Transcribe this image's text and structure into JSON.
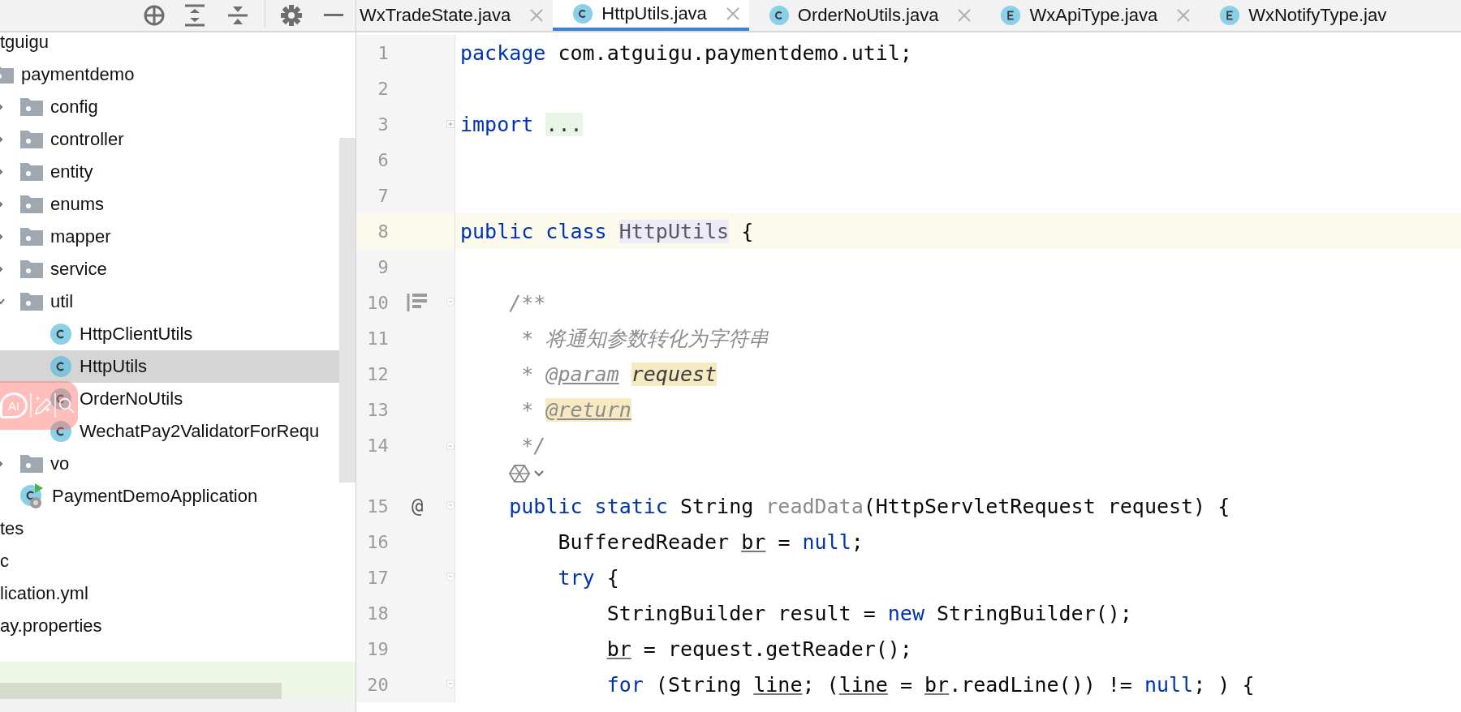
{
  "project_panel": {
    "tree": [
      {
        "label": "tguigu",
        "selected": false,
        "children": [
          {
            "label": "paymentdemo",
            "kind": "folder",
            "selected": false,
            "children": [
              {
                "label": "config",
                "kind": "folder",
                "expanded": false,
                "selected": false
              },
              {
                "label": "controller",
                "kind": "folder",
                "expanded": false,
                "selected": false
              },
              {
                "label": "entity",
                "kind": "folder",
                "expanded": false,
                "selected": false
              },
              {
                "label": "enums",
                "kind": "folder",
                "expanded": false,
                "selected": false
              },
              {
                "label": "mapper",
                "kind": "folder",
                "expanded": false,
                "selected": false
              },
              {
                "label": "service",
                "kind": "folder",
                "expanded": false,
                "selected": false
              },
              {
                "label": "util",
                "kind": "folder",
                "expanded": true,
                "selected": false,
                "children": [
                  {
                    "label": "HttpClientUtils",
                    "kind": "class",
                    "selected": false
                  },
                  {
                    "label": "HttpUtils",
                    "kind": "class",
                    "selected": true
                  },
                  {
                    "label": "OrderNoUtils",
                    "kind": "class",
                    "selected": false
                  },
                  {
                    "label": "WechatPay2ValidatorForRequ",
                    "kind": "class",
                    "selected": false
                  }
                ]
              },
              {
                "label": "vo",
                "kind": "folder",
                "expanded": false,
                "selected": false
              },
              {
                "label": "PaymentDemoApplication",
                "kind": "app-class",
                "selected": false
              }
            ]
          }
        ]
      },
      {
        "label": "tes",
        "selected": false
      },
      {
        "label": "c",
        "selected": false
      },
      {
        "label": "lication.yml",
        "selected": false
      },
      {
        "label": "ay.properties",
        "selected": false
      }
    ]
  },
  "overlay_menu": {
    "label": "AI"
  },
  "tabs": [
    {
      "label": "WxTradeState.java",
      "closable": true,
      "selected": false
    },
    {
      "label": "HttpUtils.java",
      "kind": "class",
      "closable": true,
      "selected": true
    },
    {
      "label": "OrderNoUtils.java",
      "kind": "class",
      "closable": true,
      "selected": false
    },
    {
      "label": "WxApiType.java",
      "kind": "enum",
      "closable": true,
      "selected": false
    },
    {
      "label": "WxNotifyType.jav",
      "kind": "enum",
      "closable": false,
      "selected": false
    }
  ],
  "editor": {
    "lines": [
      {
        "kind": "code",
        "number": "1",
        "tokens": [
          {
            "text": "package ",
            "kind": "keyword"
          },
          {
            "text": "com.atguigu.paymentdemo.util;",
            "kind": "plain"
          }
        ]
      },
      {
        "kind": "code",
        "number": "2"
      },
      {
        "kind": "code",
        "number": "3",
        "fold": {
          "kind": "collapsed"
        },
        "tokens": [
          {
            "text": "import ",
            "kind": "keyword"
          },
          {
            "text": "...",
            "kind": "folded"
          }
        ]
      },
      {
        "kind": "code",
        "number": "6"
      },
      {
        "kind": "code",
        "number": "7"
      },
      {
        "kind": "code",
        "number": "8",
        "current": true,
        "tokens": [
          {
            "text": "public class ",
            "kind": "keyword"
          },
          {
            "text": "HttpUtils",
            "kind": "declared"
          },
          {
            "text": " {",
            "kind": "plain"
          }
        ]
      },
      {
        "kind": "code",
        "number": "9"
      },
      {
        "kind": "code",
        "number": "10",
        "doc_toggle": true,
        "fold": {
          "kind": "start"
        },
        "tokens": [
          {
            "text": "    /**",
            "kind": "comment"
          }
        ]
      },
      {
        "kind": "code",
        "number": "11",
        "tokens": [
          {
            "text": "     * 将通知参数转化为字符串",
            "kind": "comment"
          }
        ]
      },
      {
        "kind": "code",
        "number": "12",
        "tokens": [
          {
            "text": "     * ",
            "kind": "comment"
          },
          {
            "text": "@param",
            "kind": "doctag"
          },
          {
            "text": " request",
            "kind": "docparam"
          }
        ]
      },
      {
        "kind": "code",
        "number": "13",
        "tokens": [
          {
            "text": "     * ",
            "kind": "comment"
          },
          {
            "text": "@return",
            "kind": "doctag-marked"
          }
        ]
      },
      {
        "kind": "code",
        "number": "14",
        "fold": {
          "kind": "end"
        },
        "tokens": [
          {
            "text": "     */",
            "kind": "comment"
          }
        ]
      },
      {
        "kind": "inlay"
      },
      {
        "kind": "code",
        "number": "15",
        "gutter_text": "@",
        "fold": {
          "kind": "start"
        },
        "tokens": [
          {
            "text": "    public static ",
            "kind": "keyword"
          },
          {
            "text": "String ",
            "kind": "plain"
          },
          {
            "text": "readData",
            "kind": "unused"
          },
          {
            "text": "(HttpServletRequest request) {",
            "kind": "plain"
          }
        ]
      },
      {
        "kind": "code",
        "number": "16",
        "tokens": [
          {
            "text": "        BufferedReader ",
            "kind": "plain"
          },
          {
            "text": "br",
            "kind": "variable"
          },
          {
            "text": " = ",
            "kind": "plain"
          },
          {
            "text": "null",
            "kind": "keyword"
          },
          {
            "text": ";",
            "kind": "plain"
          }
        ]
      },
      {
        "kind": "code",
        "number": "17",
        "fold": {
          "kind": "start"
        },
        "tokens": [
          {
            "text": "        try",
            "kind": "keyword"
          },
          {
            "text": " {",
            "kind": "plain"
          }
        ]
      },
      {
        "kind": "code",
        "number": "18",
        "tokens": [
          {
            "text": "            StringBuilder result = ",
            "kind": "plain"
          },
          {
            "text": "new",
            "kind": "keyword"
          },
          {
            "text": " StringBuilder();",
            "kind": "plain"
          }
        ]
      },
      {
        "kind": "code",
        "number": "19",
        "tokens": [
          {
            "text": "            br",
            "kind": "variable"
          },
          {
            "text": " = request.getReader();",
            "kind": "plain"
          }
        ]
      },
      {
        "kind": "code",
        "number": "20",
        "fold": {
          "kind": "start"
        },
        "tokens": [
          {
            "text": "            for",
            "kind": "keyword"
          },
          {
            "text": " (String ",
            "kind": "plain"
          },
          {
            "text": "line",
            "kind": "variable"
          },
          {
            "text": "; (",
            "kind": "plain"
          },
          {
            "text": "line",
            "kind": "variable"
          },
          {
            "text": " = ",
            "kind": "plain"
          },
          {
            "text": "br",
            "kind": "variable"
          },
          {
            "text": ".readLine()) != ",
            "kind": "plain"
          },
          {
            "text": "null",
            "kind": "keyword"
          },
          {
            "text": "; ) {",
            "kind": "plain"
          }
        ]
      }
    ]
  }
}
